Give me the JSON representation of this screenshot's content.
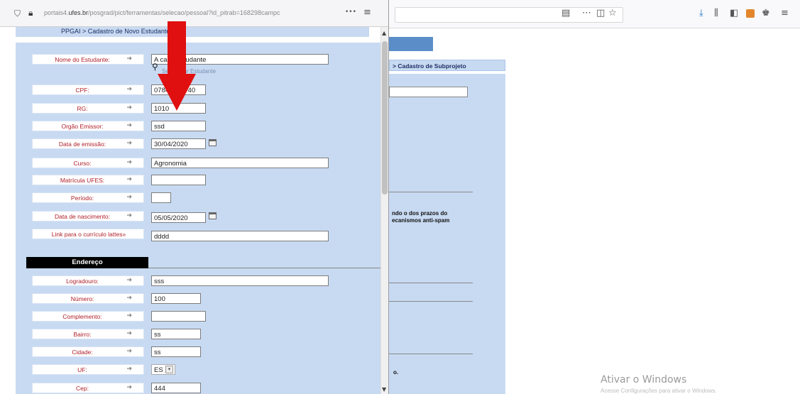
{
  "popup": {
    "url": "portais4.ufes.br/posgrad/pict/ferramentas/selecao/pessoal?id_pitrab=168298campc",
    "url_domain": "ufes.br",
    "url_prefix": "portais4.",
    "url_suffix": "/posgrad/pict/ferramentas/selecao/pessoal?id_pitrab=168298campc",
    "more_label": "•••",
    "breadcrumb": "PPGAI > Cadastro de Novo Estudante",
    "select_student_link": "Selecionar Estudante",
    "section_title": "Endereço",
    "fields": [
      {
        "label": "Nome do Estudante:",
        "value": "A cada estudante"
      },
      {
        "label": "CPF:",
        "value": "07844784740"
      },
      {
        "label": "RG:",
        "value": "1010"
      },
      {
        "label": "Orgão Emissor:",
        "value": "ssd"
      },
      {
        "label": "Data de emissão:",
        "value": "30/04/2020"
      },
      {
        "label": "Curso:",
        "value": "Agronomia"
      },
      {
        "label": "Matrícula UFES:",
        "value": ""
      },
      {
        "label": "Período:",
        "value": ""
      },
      {
        "label": "Data de nascimento:",
        "value": "05/05/2020"
      },
      {
        "label": "Link para o currículo lattes»",
        "value": "dddd"
      }
    ],
    "address_fields": [
      {
        "label": "Logradouro:",
        "value": "sss"
      },
      {
        "label": "Número:",
        "value": "100"
      },
      {
        "label": "Complemento:",
        "value": ""
      },
      {
        "label": "Bairro:",
        "value": "ss"
      },
      {
        "label": "Cidade:",
        "value": "ss"
      },
      {
        "label": "UF:",
        "value": "ES"
      },
      {
        "label": "Cep:",
        "value": "444"
      }
    ],
    "arrow_glyph": "➔"
  },
  "background": {
    "breadcrumb": "> Cadastro de Subprojeto",
    "warning_text": "ndo o dos prazos do\necanismos anti-spam",
    "fragment": "o.",
    "windows_watermark": "Ativar o Windows",
    "windows_watermark_sub": "Acesse Configurações para ativar o Windows."
  },
  "colors": {
    "panel": "#c8daf2",
    "label_text": "#b0202a",
    "annotation_arrow": "#e01010"
  },
  "icons": [
    "shield-icon",
    "lock-icon",
    "page-icon",
    "meatball-menu-icon",
    "pocket-icon",
    "bookmark-star-icon",
    "download-icon",
    "library-icon",
    "reader-icon",
    "extension-icon",
    "hamburger-menu-icon",
    "search-icon",
    "calendar-icon"
  ]
}
